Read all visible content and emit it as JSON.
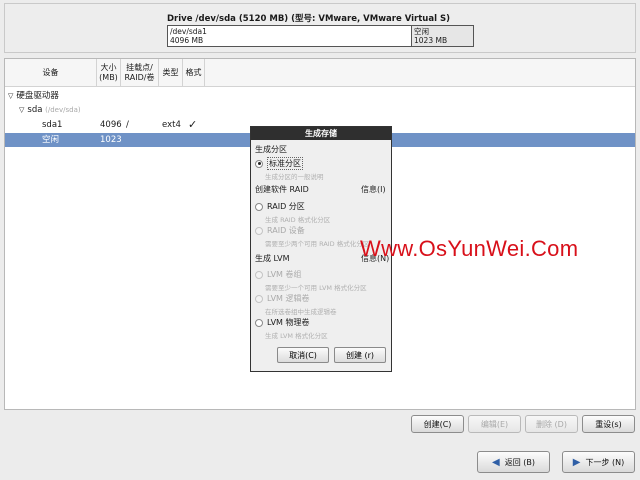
{
  "drive": {
    "title": "Drive /dev/sda (5120 MB) (型号: VMware, VMware Virtual S)",
    "segments": [
      {
        "name": "/dev/sda1",
        "size": "4096 MB"
      },
      {
        "name": "空闲",
        "size": "1023 MB"
      }
    ]
  },
  "table": {
    "headers": {
      "device": "设备",
      "size": "大小\n(MB)",
      "mount": "挂载点/\nRAID/卷",
      "type": "类型",
      "format": "格式"
    },
    "rows": {
      "group": {
        "label": "硬盘驱动器"
      },
      "disk": {
        "label": "sda",
        "path": "(/dev/sda)"
      },
      "part1": {
        "device": "sda1",
        "size": "4096",
        "mount": "/",
        "type": "ext4",
        "format": "✓"
      },
      "free": {
        "device": "空闲",
        "size": "1023"
      }
    }
  },
  "dialog": {
    "title": "生成存储",
    "section_partition": "生成分区",
    "opt_standard": {
      "label": "标准分区",
      "desc": "生成分区的一般说明"
    },
    "section_raid": "创建软件 RAID",
    "info_raid": "信息(I)",
    "opt_raid_partition": {
      "label": "RAID 分区",
      "desc": "生成 RAID 格式化分区"
    },
    "opt_raid_device": {
      "label": "RAID 设备",
      "desc": "需要至少两个可用 RAID 格式化分区"
    },
    "section_lvm": "生成 LVM",
    "info_lvm": "信息(N)",
    "opt_lvm_group": {
      "label": "LVM 卷组",
      "desc": "需要至少一个可用 LVM 格式化分区"
    },
    "opt_lvm_logical": {
      "label": "LVM 逻辑卷",
      "desc": "在所选卷组中生成逻辑卷"
    },
    "opt_lvm_physical": {
      "label": "LVM 物理卷",
      "desc": "生成 LVM 格式化分区"
    },
    "cancel": "取消(C)",
    "create": "创建 (r)"
  },
  "watermark": "Www.OsYunWei.Com",
  "actions": {
    "create": "创建(C)",
    "edit": "编辑(E)",
    "delete": "删除 (D)",
    "reset": "重设(s)"
  },
  "nav": {
    "back": "返回 (B)",
    "next": "下一步 (N)"
  },
  "icons": {
    "expand": "triangle-down",
    "radio_selected": "radio-filled",
    "back": "arrow-left",
    "next": "arrow-right"
  },
  "colors": {
    "selection": "#6f92c6",
    "dialog_titlebar": "#2f2f2f",
    "watermark": "#d8101a"
  }
}
